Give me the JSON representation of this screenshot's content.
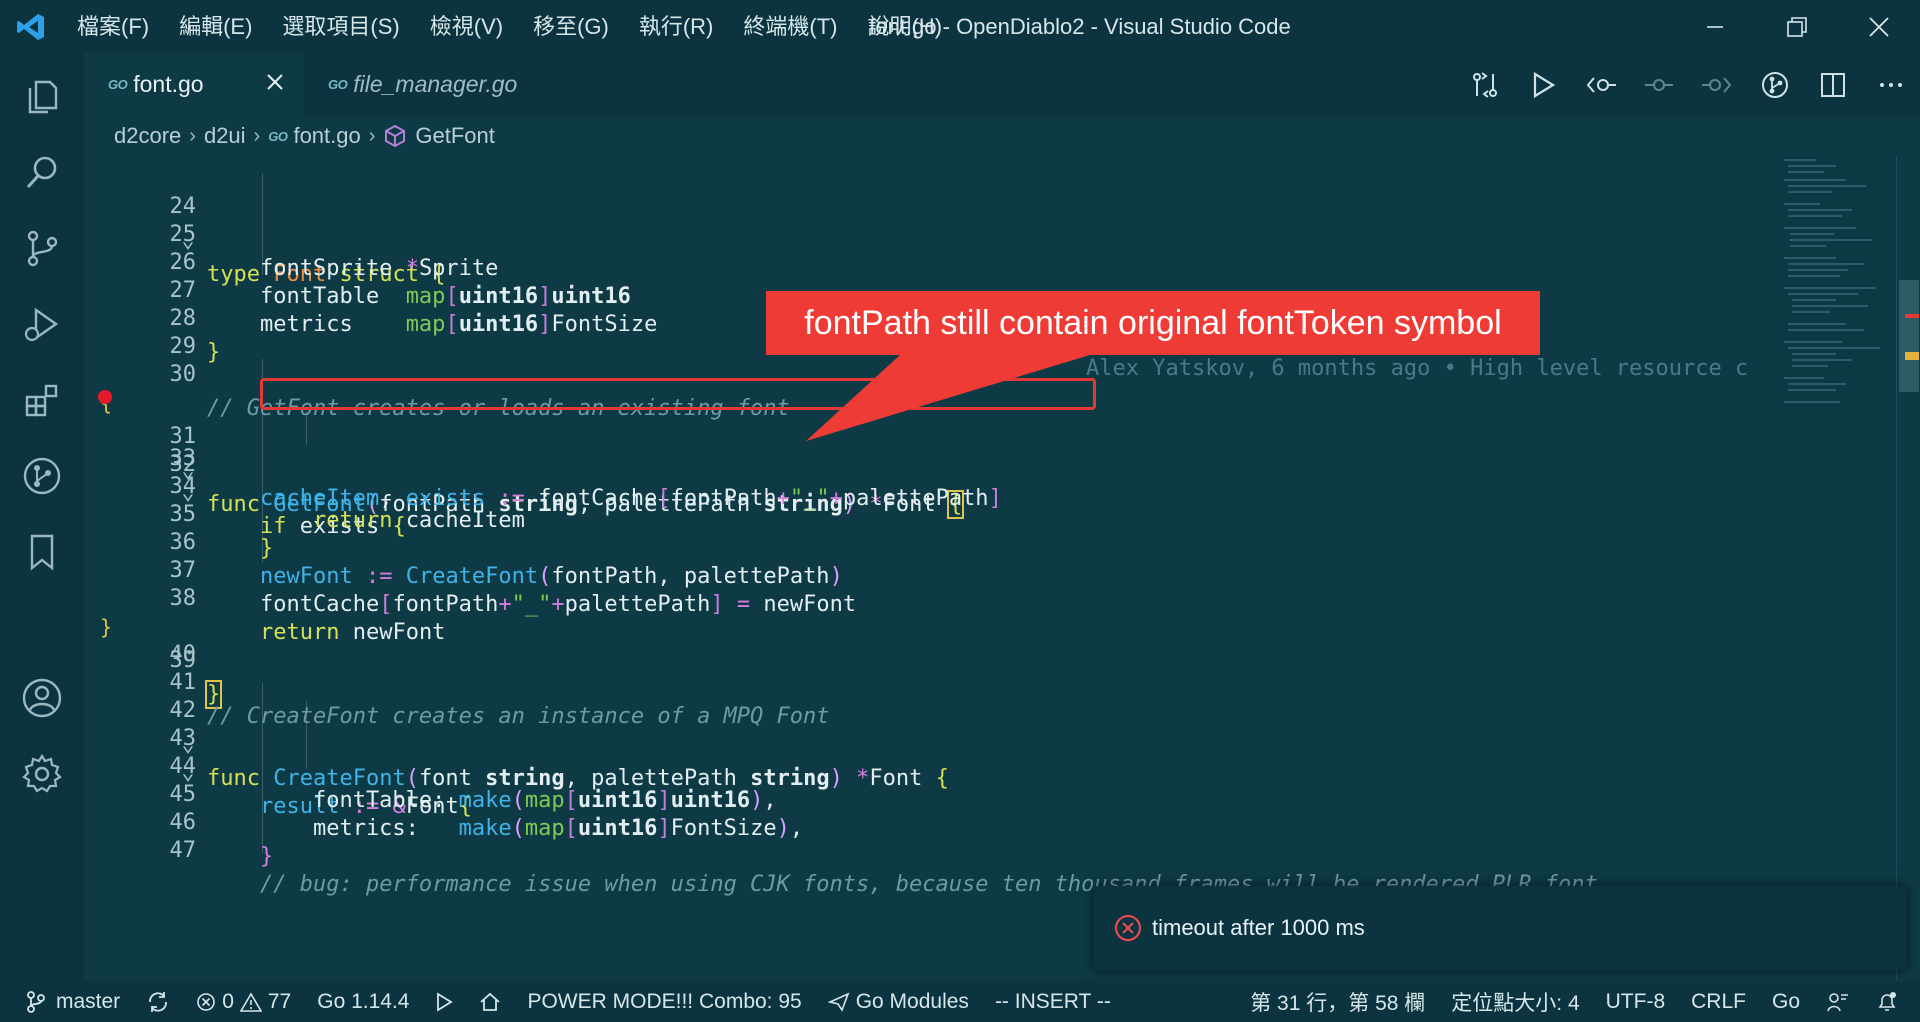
{
  "window": {
    "title": "font.go - OpenDiablo2 - Visual Studio Code"
  },
  "menu": [
    "檔案(F)",
    "編輯(E)",
    "選取項目(S)",
    "檢視(V)",
    "移至(G)",
    "執行(R)",
    "終端機(T)",
    "說明(H)"
  ],
  "tabs": [
    {
      "label": "font.go",
      "badge": "GO",
      "active": true
    },
    {
      "label": "file_manager.go",
      "badge": "GO",
      "active": false
    }
  ],
  "breadcrumb": {
    "items": [
      "d2core",
      "d2ui",
      "font.go",
      "GetFont"
    ],
    "file_badge": "GO"
  },
  "editor": {
    "blame": "Alex Yatskov, 6 months ago • High level resource c",
    "line_numbers": [
      "24",
      "25",
      "26",
      "27",
      "28",
      "29",
      "30",
      "31",
      "32",
      "33",
      "34",
      "35",
      "36",
      "37",
      "38",
      "39",
      "40",
      "41",
      "42",
      "43",
      "44",
      "45",
      "46",
      "47"
    ]
  },
  "callout": {
    "text": "fontPath still contain original fontToken symbol"
  },
  "notification": {
    "text": "timeout after 1000 ms"
  },
  "statusbar": {
    "branch": "master",
    "errors": "0",
    "warnings": "77",
    "go_version": "Go 1.14.4",
    "power_mode": "POWER MODE!!! Combo: 95",
    "go_modules": "Go Modules",
    "vim_mode": "-- INSERT --",
    "cursor": "第 31 行，第 58 欄",
    "indent": "定位點大小: 4",
    "encoding": "UTF-8",
    "eol": "CRLF",
    "language": "Go"
  },
  "colors": {
    "accent": "#ef3b36",
    "background": "#0d3a45",
    "chrome": "#0c3440"
  }
}
